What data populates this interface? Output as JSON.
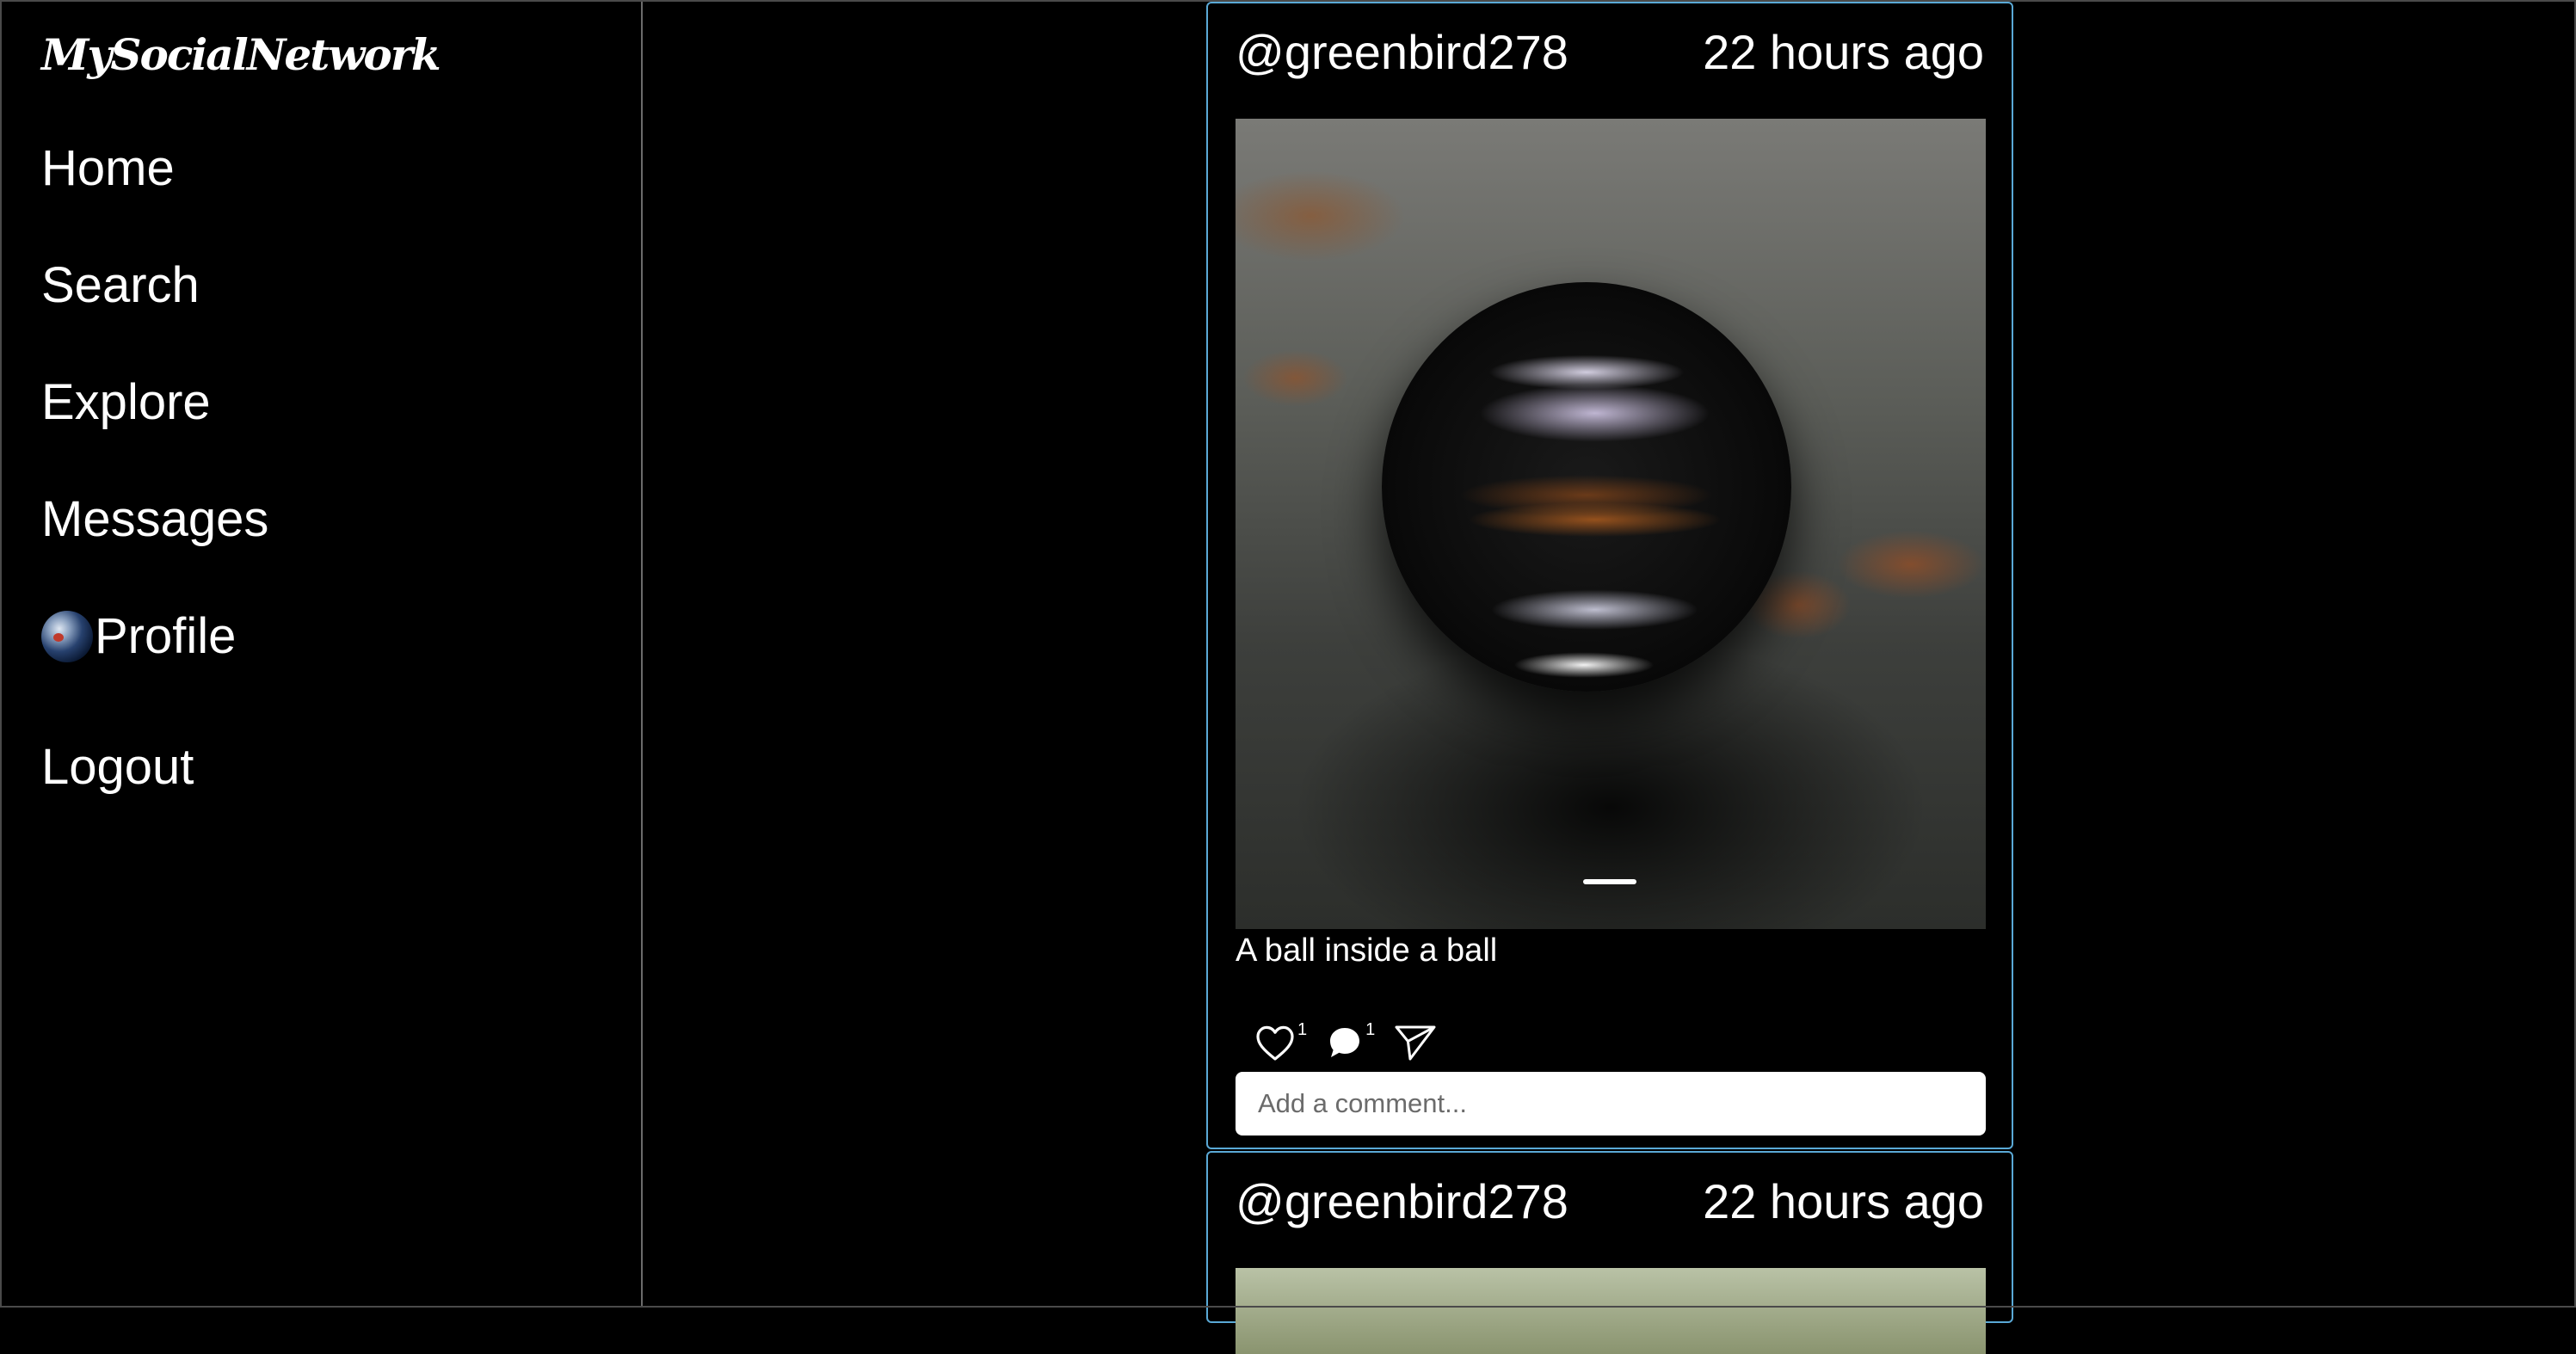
{
  "app": {
    "brand": "MySocialNetwork"
  },
  "sidebar": {
    "items": [
      {
        "label": "Home"
      },
      {
        "label": "Search"
      },
      {
        "label": "Explore"
      },
      {
        "label": "Messages"
      },
      {
        "label": "Profile",
        "icon": "avatar"
      },
      {
        "label": "Logout"
      }
    ]
  },
  "posts": [
    {
      "username": "@greenbird278",
      "time": "22 hours ago",
      "image": "glass-sphere-photo",
      "caption": "A ball inside a ball",
      "likes": "1",
      "comments": "1",
      "comment_placeholder": "Add a comment..."
    },
    {
      "username": "@greenbird278",
      "time": "22 hours ago",
      "image": "nature-photo"
    }
  ],
  "colors": {
    "background": "#000000",
    "post_border": "#5aa9d6",
    "sidebar_divider": "#6b6b6b",
    "text": "#ffffff"
  }
}
